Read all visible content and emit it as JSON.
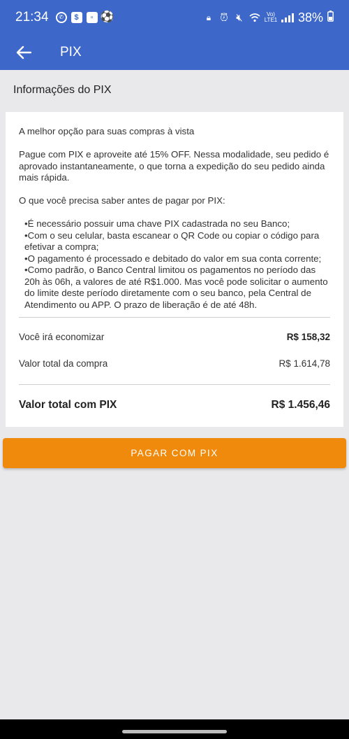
{
  "status_bar": {
    "time": "21:34",
    "network": "Vo) LTE1",
    "battery": "38%",
    "left_icons": [
      "whatsapp-icon",
      "dollar-app-icon",
      "square-app-icon",
      "soccer-ball-icon"
    ],
    "right_icons": [
      "lock-icon",
      "alarm-icon",
      "mute-icon",
      "wifi-icon",
      "signal-icon",
      "battery-icon"
    ]
  },
  "toolbar": {
    "title": "PIX"
  },
  "section": {
    "title": "Informações do PIX"
  },
  "info": {
    "headline": "A melhor opção para suas compras à vista",
    "intro": "Pague com PIX e aproveite até 15% OFF. Nessa modalidade, seu pedido é aprovado instantaneamente, o que torna a expedição do seu pedido ainda mais rápida.",
    "subtitle": "O que você precisa saber antes de pagar por PIX:",
    "bullets": [
      "É necessário possuir uma chave PIX cadastrada no seu Banco;",
      "Com o seu celular, basta escanear o QR Code ou copiar o código para efetivar a compra;",
      "O pagamento é processado e debitado do valor em sua conta corrente;",
      "Como padrão, o Banco Central limitou os pagamentos no período das 20h às 06h, a valores de até R$1.000. Mas você pode solicitar o aumento do limite deste período diretamente com o seu banco, pela Central de Atendimento ou APP. O prazo de liberação é de até 48h."
    ]
  },
  "summary": {
    "savings_label": "Você irá economizar",
    "savings_value": "R$ 158,32",
    "total_label": "Valor total da compra",
    "total_value": "R$ 1.614,78",
    "pix_total_label": "Valor total com PIX",
    "pix_total_value": "R$ 1.456,46"
  },
  "pay_button": {
    "label": "PAGAR COM PIX",
    "color": "#f08a0c"
  },
  "colors": {
    "appbar": "#3d68c9",
    "background": "#e9e9ec"
  }
}
